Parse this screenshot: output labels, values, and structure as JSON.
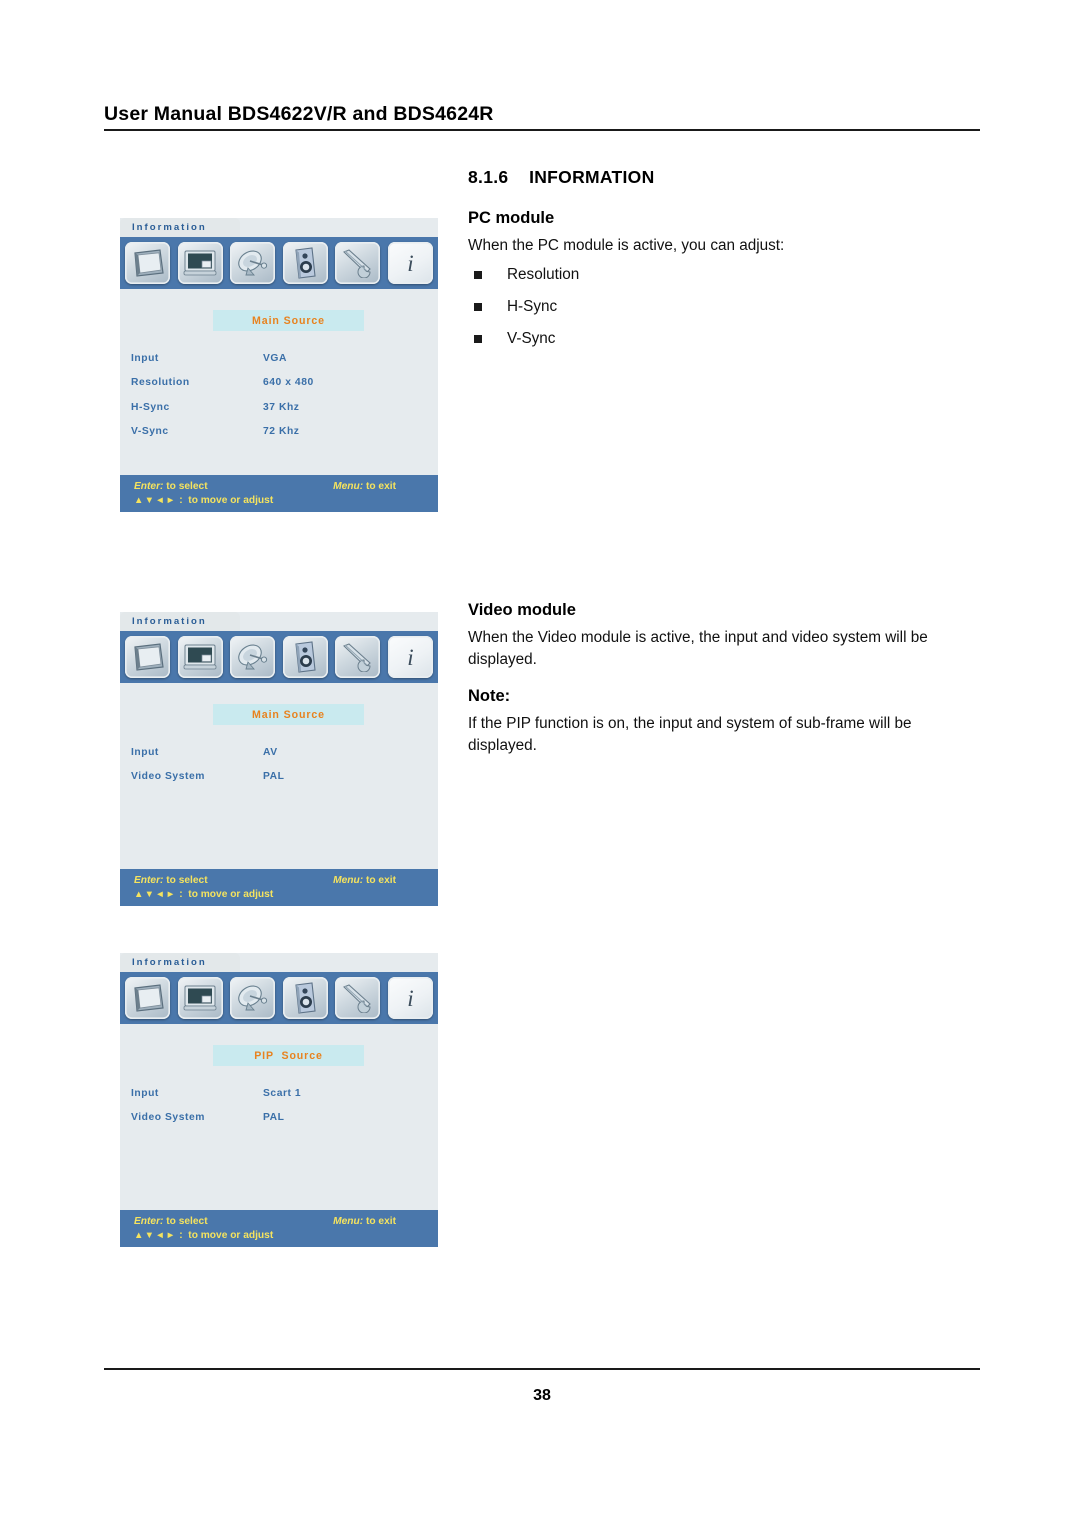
{
  "document": {
    "running_head": "User Manual BDS4622V/R and BDS4624R",
    "page_number": "38"
  },
  "section": {
    "number": "8.1.6",
    "title": "INFORMATION",
    "heading_line": "8.1.6    INFORMATION"
  },
  "pc_module": {
    "heading": "PC module",
    "intro": "When the PC module is active, you can adjust:",
    "bullets": [
      "Resolution",
      "H-Sync",
      "V-Sync"
    ]
  },
  "video_module": {
    "heading": "Video module",
    "intro": "When the Video module is active, the input and video system will be displayed.",
    "note_label": "Note:",
    "note_text": "If the PIP function is on, the input and system of sub-frame will be displayed."
  },
  "osd_common": {
    "tab_label": "Information",
    "icons": [
      {
        "name": "tv-monitor-icon",
        "active": false
      },
      {
        "name": "pip-screen-icon",
        "active": false
      },
      {
        "name": "satellite-dish-icon",
        "active": false
      },
      {
        "name": "speaker-icon",
        "active": false
      },
      {
        "name": "wrench-tool-icon",
        "active": false
      },
      {
        "name": "information-i-icon",
        "active": true,
        "glyph": "i"
      }
    ],
    "footer": {
      "enter_label": "Enter:",
      "enter_text": " to select",
      "menu_label": "Menu:",
      "menu_text": " to exit",
      "arrows": "▲▼◄►",
      "arrows_text": " :  to move or adjust"
    },
    "colors": {
      "icon_bar": "#4a77ab",
      "panel_bg": "#e6ebee",
      "source_band": "#c9eaef",
      "source_text": "#e8821e",
      "row_text": "#3a6fa8",
      "footer_text": "#f5e35e"
    }
  },
  "osd_panels": [
    {
      "id": "osd-pc-module",
      "source_label": "Main Source",
      "rows": [
        {
          "key": "Input",
          "value": "VGA"
        },
        {
          "key": "Resolution",
          "value": "640 x 480"
        },
        {
          "key": "H-Sync",
          "value": "37 Khz"
        },
        {
          "key": "V-Sync",
          "value": "72 Khz"
        }
      ]
    },
    {
      "id": "osd-video-module",
      "source_label": "Main Source",
      "rows": [
        {
          "key": "Input",
          "value": "AV"
        },
        {
          "key": "Video System",
          "value": "PAL"
        }
      ]
    },
    {
      "id": "osd-pip-source",
      "source_label": "PIP  Source",
      "rows": [
        {
          "key": "Input",
          "value": "Scart 1"
        },
        {
          "key": "Video System",
          "value": "PAL"
        }
      ]
    }
  ]
}
